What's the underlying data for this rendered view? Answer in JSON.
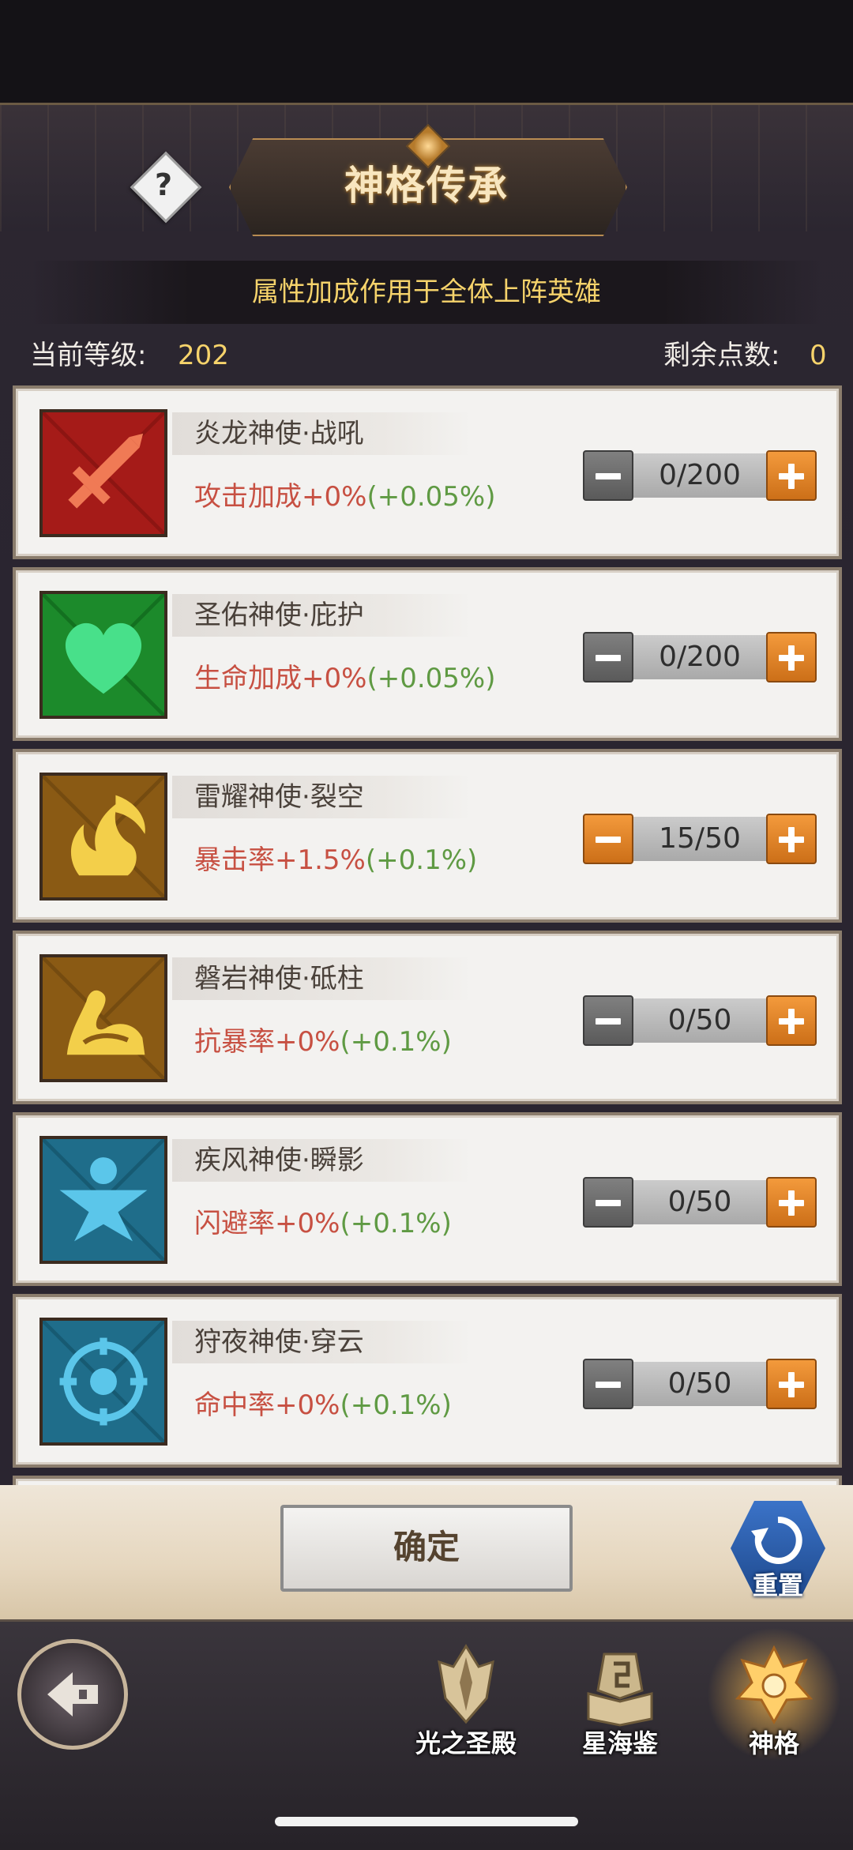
{
  "header": {
    "title": "神格传承",
    "help_icon": "question-mark-icon",
    "subtitle": "属性加成作用于全体上阵英雄"
  },
  "status": {
    "level_label": "当前等级:",
    "level_value": "202",
    "points_label": "剩余点数:",
    "points_value": "0"
  },
  "talents": [
    {
      "name": "炎龙神使·战吼",
      "effect": "攻击加成+0%",
      "bonus": "(+0.05%)",
      "value": "0/200",
      "icon": "sword-icon",
      "color": "#b8201c",
      "minus_active": false
    },
    {
      "name": "圣佑神使·庇护",
      "effect": "生命加成+0%",
      "bonus": "(+0.05%)",
      "value": "0/200",
      "icon": "heart-icon",
      "color": "#1f8a2e",
      "minus_active": false
    },
    {
      "name": "雷耀神使·裂空",
      "effect": "暴击率+1.5%",
      "bonus": "(+0.1%)",
      "value": "15/50",
      "icon": "flame-icon",
      "color": "#8a5a14",
      "minus_active": true
    },
    {
      "name": "磐岩神使·砥柱",
      "effect": "抗暴率+0%",
      "bonus": "(+0.1%)",
      "value": "0/50",
      "icon": "arm-icon",
      "color": "#8a5a14",
      "minus_active": false
    },
    {
      "name": "疾风神使·瞬影",
      "effect": "闪避率+0%",
      "bonus": "(+0.1%)",
      "value": "0/50",
      "icon": "dodge-figure-icon",
      "color": "#1f6d8a",
      "minus_active": false
    },
    {
      "name": "狩夜神使·穿云",
      "effect": "命中率+0%",
      "bonus": "(+0.1%)",
      "value": "0/50",
      "icon": "crosshair-icon",
      "color": "#1f6d8a",
      "minus_active": false
    }
  ],
  "actions": {
    "confirm_label": "确定",
    "reset_label": "重置",
    "reset_icon": "refresh-icon"
  },
  "nav": {
    "back_icon": "back-arrow-icon",
    "items": [
      {
        "label": "光之圣殿",
        "icon": "temple-crest-icon",
        "active": false
      },
      {
        "label": "星海鉴",
        "icon": "book-icon",
        "active": false
      },
      {
        "label": "神格",
        "icon": "divine-crest-icon",
        "active": true
      }
    ]
  }
}
